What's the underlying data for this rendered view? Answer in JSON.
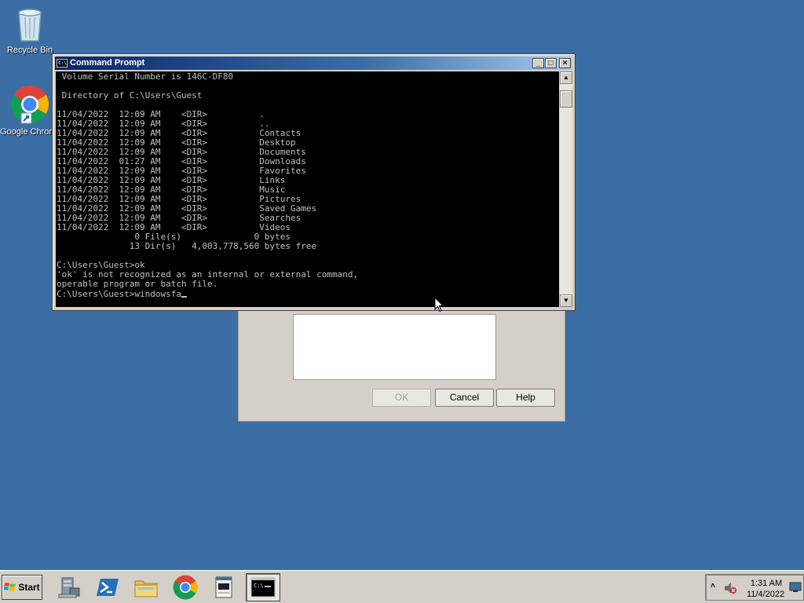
{
  "desktop": {
    "icons": [
      {
        "label": "Recycle Bin"
      },
      {
        "label": "Google Chrome"
      }
    ]
  },
  "cmd_window": {
    "title": "Command Prompt",
    "console_lines": [
      " Volume Serial Number is 146C-DF80",
      "",
      " Directory of C:\\Users\\Guest",
      "",
      "11/04/2022  12:09 AM    <DIR>          .",
      "11/04/2022  12:09 AM    <DIR>          ..",
      "11/04/2022  12:09 AM    <DIR>          Contacts",
      "11/04/2022  12:09 AM    <DIR>          Desktop",
      "11/04/2022  12:09 AM    <DIR>          Documents",
      "11/04/2022  01:27 AM    <DIR>          Downloads",
      "11/04/2022  12:09 AM    <DIR>          Favorites",
      "11/04/2022  12:09 AM    <DIR>          Links",
      "11/04/2022  12:09 AM    <DIR>          Music",
      "11/04/2022  12:09 AM    <DIR>          Pictures",
      "11/04/2022  12:09 AM    <DIR>          Saved Games",
      "11/04/2022  12:09 AM    <DIR>          Searches",
      "11/04/2022  12:09 AM    <DIR>          Videos",
      "               0 File(s)              0 bytes",
      "              13 Dir(s)   4,003,778,560 bytes free",
      "",
      "C:\\Users\\Guest>ok",
      "'ok' is not recognized as an internal or external command,",
      "operable program or batch file.",
      ""
    ],
    "prompt_line": "C:\\Users\\Guest>windowsfa"
  },
  "background_dialog": {
    "ok_label": "OK",
    "cancel_label": "Cancel",
    "help_label": "Help"
  },
  "taskbar": {
    "start_label": "Start",
    "apps": [
      {
        "icon": "server-manager-icon"
      },
      {
        "icon": "powershell-icon"
      },
      {
        "icon": "file-explorer-icon"
      },
      {
        "icon": "chrome-icon"
      },
      {
        "icon": "run-dialog-icon"
      },
      {
        "icon": "command-prompt-icon"
      }
    ],
    "clock": {
      "time": "1:31 AM",
      "date": "11/4/2022"
    }
  },
  "colors": {
    "desktop_bg": "#3a6ea5",
    "console_bg": "#000000",
    "console_fg": "#c0c0c0"
  }
}
